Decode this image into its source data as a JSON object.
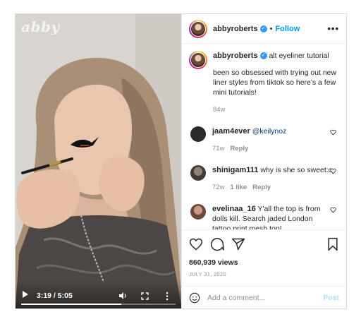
{
  "video": {
    "watermark": "abby",
    "time": "3:19 / 5:05",
    "progress": 0.65
  },
  "header": {
    "username": "abbyroberts",
    "verified_mark": "✓",
    "separator": "•",
    "follow_label": "Follow",
    "more_label": "•••"
  },
  "caption": {
    "username": "abbyroberts",
    "title": "alt eyeliner tutorial",
    "text": "been so obsessed with trying out new liner styles from tiktok so here's a few mini tutorials!",
    "age": "84w"
  },
  "comments": [
    {
      "username": "jaam4ever",
      "text": "@keilynoz",
      "age": "71w",
      "likes": "",
      "reply": "Reply",
      "avatar_color": "#2b2b2b"
    },
    {
      "username": "shinigam111",
      "text": "why is she so sweet:c",
      "age": "72w",
      "likes": "1 like",
      "reply": "Reply",
      "avatar_color": "#5a5146"
    },
    {
      "username": "evelinaa_16",
      "text": "Y'all the top is from dolls kill. Search jaded London tattoo print mesh top!",
      "age": "",
      "likes": "",
      "reply": "",
      "avatar_color": "#8a5a4a"
    }
  ],
  "stats": {
    "views": "860,939 views",
    "date": "JULY 31, 2020"
  },
  "add_comment": {
    "placeholder": "Add a comment...",
    "post_label": "Post"
  },
  "icons": [
    "play-icon",
    "volume-icon",
    "fullscreen-icon",
    "more-vertical-icon",
    "heart-icon",
    "comment-icon",
    "share-icon",
    "bookmark-icon",
    "smiley-icon"
  ],
  "colors": {
    "accent": "#0095f6",
    "verified": "#3897f0",
    "post_disabled": "#b2dffc"
  }
}
